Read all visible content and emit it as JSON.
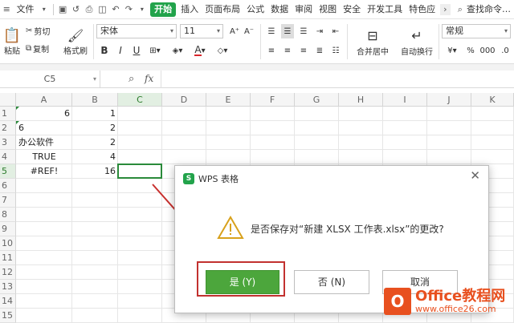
{
  "menubar": {
    "file_label": "文件",
    "tabs": [
      "开始",
      "插入",
      "页面布局",
      "公式",
      "数据",
      "审阅",
      "视图",
      "安全",
      "开发工具",
      "特色应"
    ],
    "active_tab": "开始",
    "search_label": "查找命令…"
  },
  "ribbon": {
    "paste_label": "粘贴",
    "cut_label": "剪切",
    "copy_label": "复制",
    "format_painter_label": "格式刷",
    "font_name": "宋体",
    "font_size": "11",
    "bold_label": "B",
    "italic_label": "I",
    "underline_label": "U",
    "merge_label": "合并居中",
    "wrap_label": "自动换行",
    "number_format": "常规",
    "font_color": "#d9262b"
  },
  "formula_bar": {
    "name_box": "C5",
    "fx_label": "fx"
  },
  "grid": {
    "columns": [
      "A",
      "B",
      "C",
      "D",
      "E",
      "F",
      "G",
      "H",
      "I",
      "J",
      "K"
    ],
    "rows": [
      "1",
      "2",
      "3",
      "4",
      "5",
      "6",
      "7",
      "8",
      "9",
      "10",
      "11",
      "12",
      "13",
      "14",
      "15"
    ],
    "cells": {
      "A1": "6",
      "B1": "1",
      "A2": "6",
      "B2": "2",
      "A3": "办公软件",
      "B3": "2",
      "A4": "TRUE",
      "B4": "4",
      "A5": "#REF!",
      "B5": "16"
    }
  },
  "dialog": {
    "title": "WPS 表格",
    "message": "是否保存对“新建 XLSX 工作表.xlsx”的更改?",
    "yes_label": "是 (Y)",
    "no_label": "否 (N)",
    "cancel_label": "取消",
    "accent": "#4ca63c"
  },
  "watermark": {
    "logo_letter": "O",
    "line1": "Office教程网",
    "line2": "www.office26.com"
  }
}
